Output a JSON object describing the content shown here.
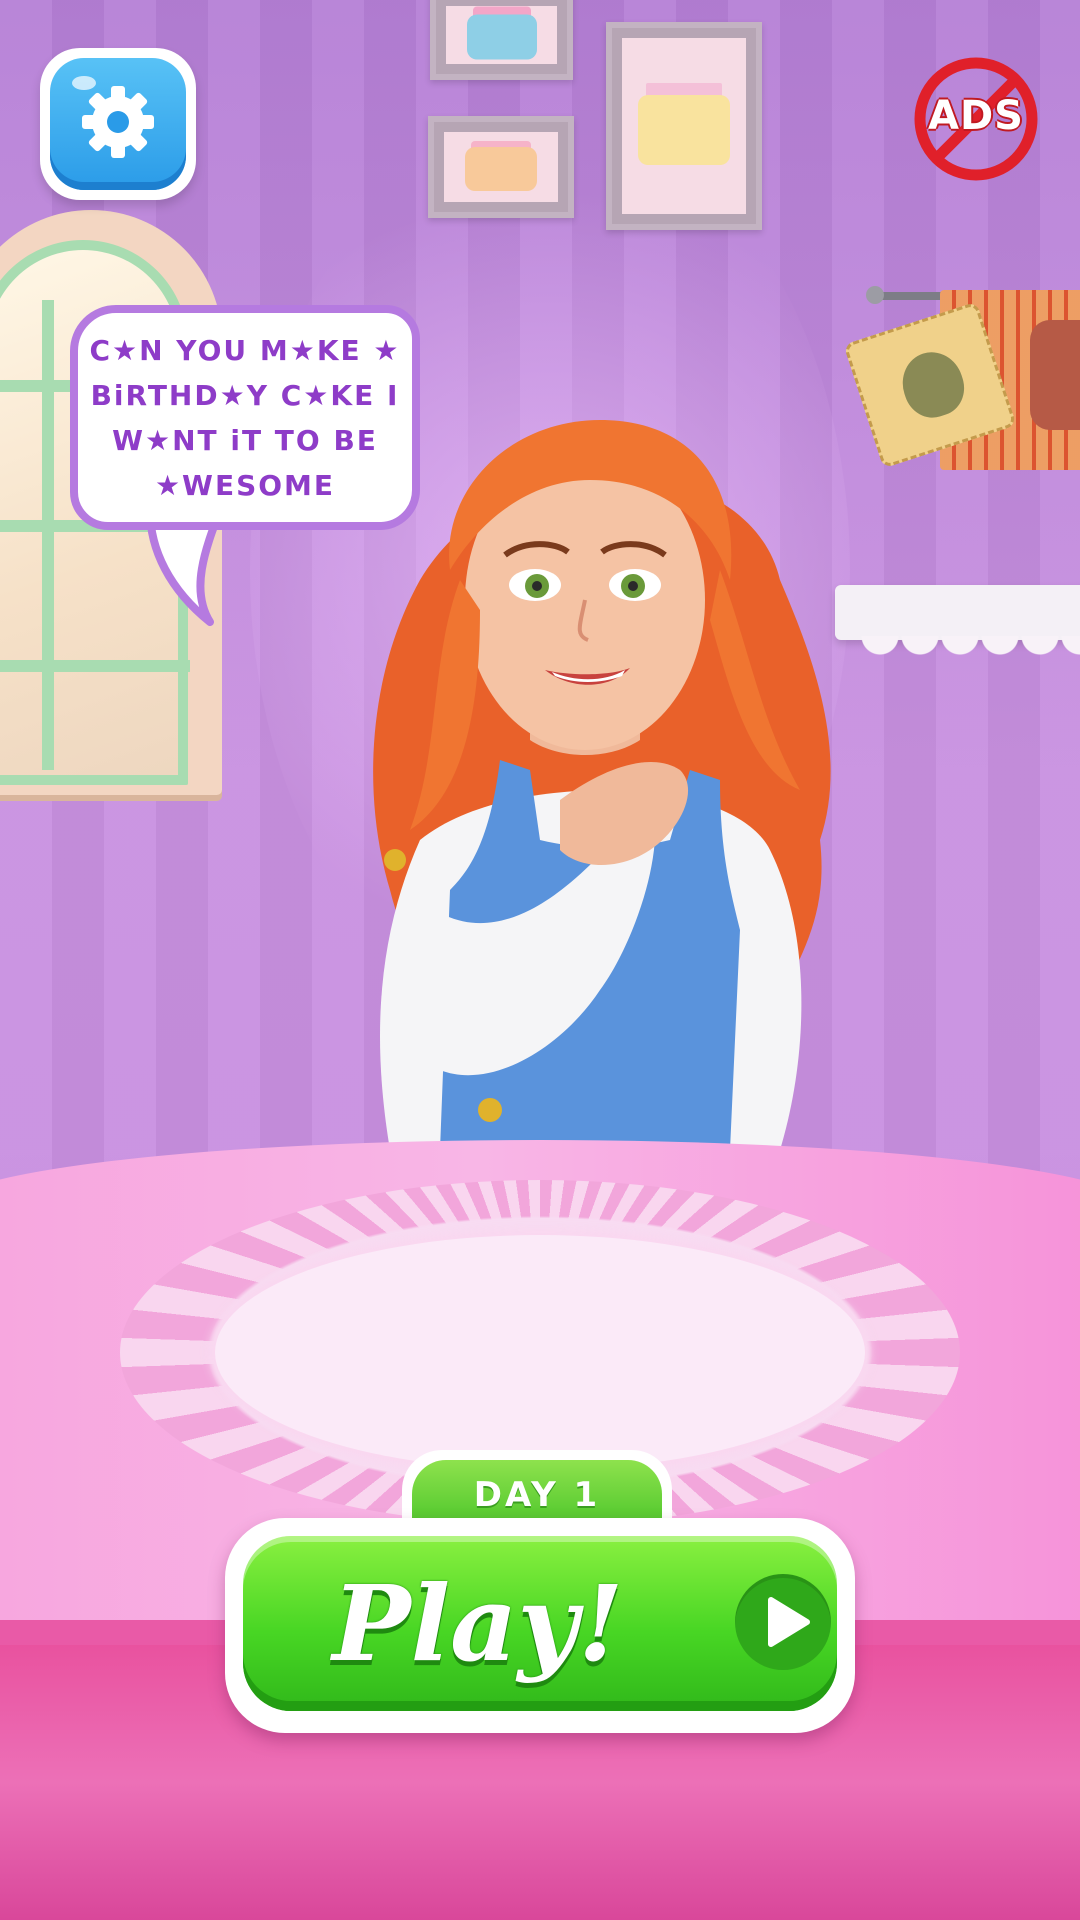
{
  "hud": {
    "settings_icon": "gear-icon",
    "ads_label": "ADS",
    "ads_icon": "no-ads-icon",
    "ads_color": "#e0202a"
  },
  "speech": {
    "text": "C★N YOU M★KE ★ BiRTHD★Y C★KE I W★NT iT TO BE ★WESOME",
    "text_color": "#8e3cc8",
    "border_color": "#b57ae0"
  },
  "play": {
    "day_label": "DAY 1",
    "button_label": "Play!",
    "play_icon": "play-triangle-icon",
    "accent": "#48d624"
  },
  "scene": {
    "wall_color": "#c890e0",
    "table_color": "#f7a5de"
  }
}
